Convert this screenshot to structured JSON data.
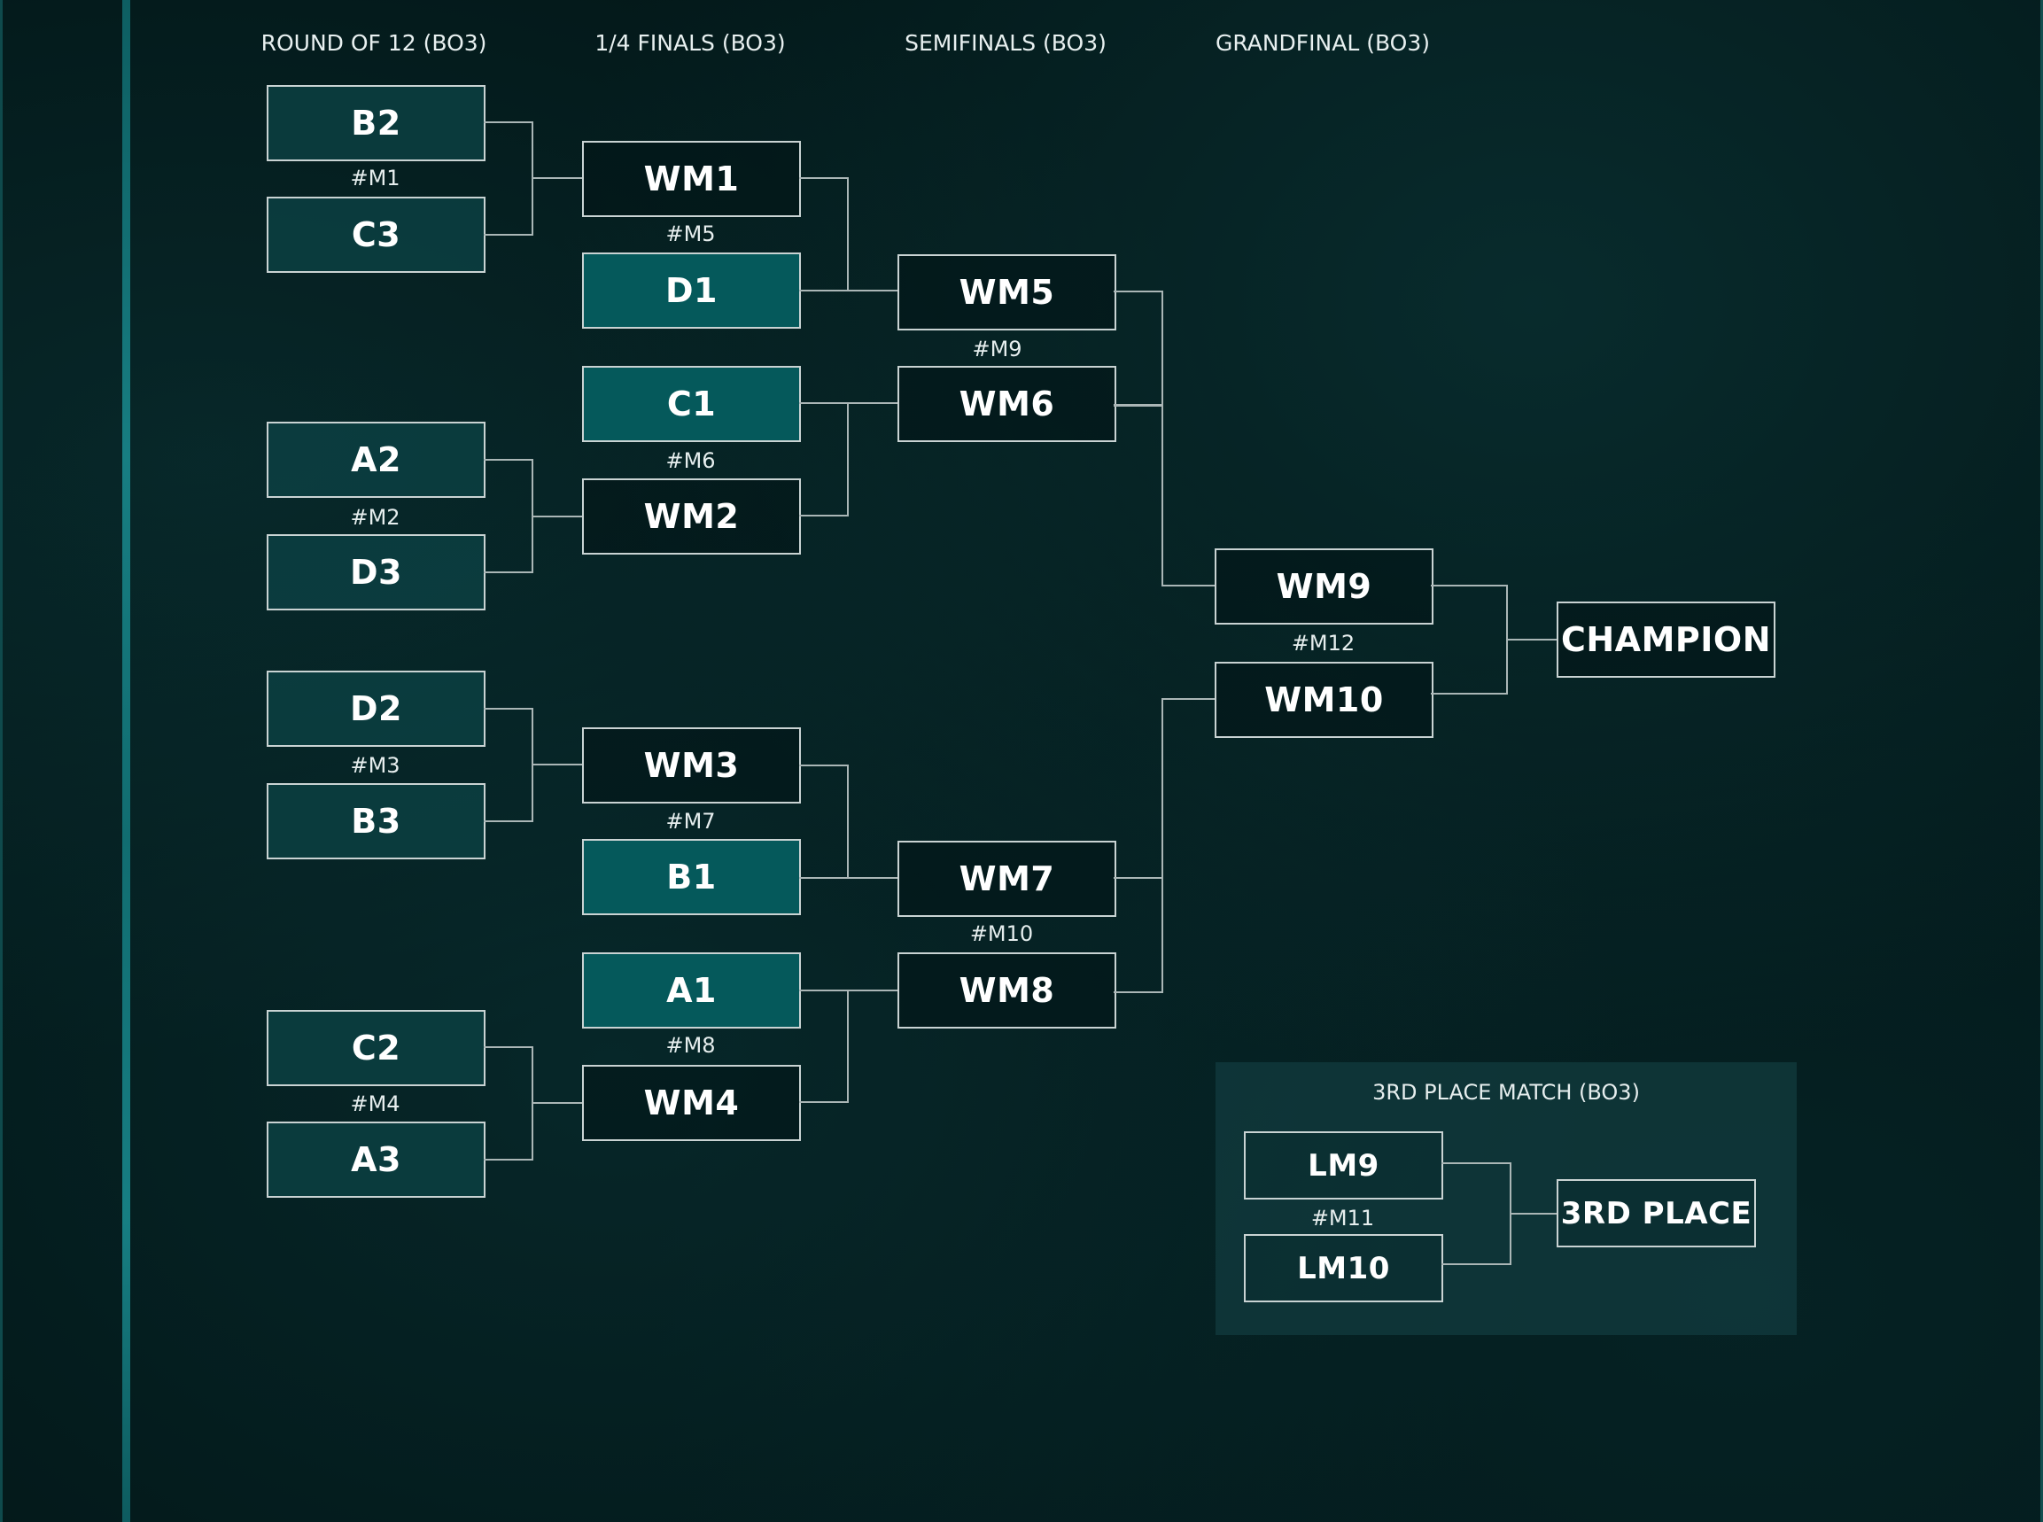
{
  "headers": {
    "round_of_12": "ROUND OF 12 (BO3)",
    "quarterfinals": "1/4 FINALS (BO3)",
    "semifinals": "SEMIFINALS (BO3)",
    "grandfinal": "GRANDFINAL (BO3)"
  },
  "colors": {
    "background": "#031718",
    "round_of_12_slot": "#0c4042",
    "seeded_slot": "#05595b",
    "border": "#c9d3d3",
    "accent_stripe": "#1a8d92"
  },
  "round_of_12": [
    {
      "id": "#M1",
      "top": "B2",
      "bottom": "C3"
    },
    {
      "id": "#M2",
      "top": "A2",
      "bottom": "D3"
    },
    {
      "id": "#M3",
      "top": "D2",
      "bottom": "B3"
    },
    {
      "id": "#M4",
      "top": "C2",
      "bottom": "A3"
    }
  ],
  "quarterfinals": [
    {
      "id": "#M5",
      "top": "WM1",
      "bottom": "D1"
    },
    {
      "id": "#M6",
      "top": "C1",
      "bottom": "WM2"
    },
    {
      "id": "#M7",
      "top": "WM3",
      "bottom": "B1"
    },
    {
      "id": "#M8",
      "top": "A1",
      "bottom": "WM4"
    }
  ],
  "semifinals": [
    {
      "id": "#M9",
      "top": "WM5",
      "bottom": "WM6"
    },
    {
      "id": "#M10",
      "top": "WM7",
      "bottom": "WM8"
    }
  ],
  "grandfinal": {
    "id": "#M12",
    "top": "WM9",
    "bottom": "WM10"
  },
  "champion": "CHAMPION",
  "third_place": {
    "title": "3RD PLACE MATCH (BO3)",
    "id": "#M11",
    "top": "LM9",
    "bottom": "LM10",
    "result": "3RD PLACE"
  }
}
